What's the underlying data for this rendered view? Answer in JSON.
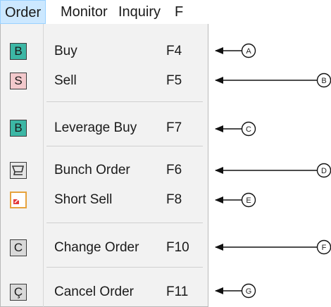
{
  "menubar": {
    "items": [
      "Order",
      "Monitor",
      "Inquiry",
      "F"
    ],
    "active": "Order"
  },
  "menu": {
    "items": [
      {
        "icon": "buy-icon",
        "icon_char": "B",
        "icon_bg": "#3cb7a5",
        "label": "Buy",
        "shortcut": "F4",
        "callout": "A"
      },
      {
        "icon": "sell-icon",
        "icon_char": "S",
        "icon_bg": "#f3c9cc",
        "label": "Sell",
        "shortcut": "F5",
        "callout": "B"
      },
      {
        "icon": "leverage-buy-icon",
        "icon_char": "B",
        "icon_bg": "#3cb7a5",
        "label": "Leverage Buy",
        "shortcut": "F7",
        "callout": "C"
      },
      {
        "icon": "bunch-order-icon",
        "icon_char": "",
        "icon_bg": "#e6e6e6",
        "label": "Bunch Order",
        "shortcut": "F6",
        "callout": "D"
      },
      {
        "icon": "short-sell-icon",
        "icon_char": "↗",
        "icon_bg": "#ffffff",
        "label": "Short Sell",
        "shortcut": "F8",
        "callout": "E"
      },
      {
        "icon": "change-order-icon",
        "icon_char": "C",
        "icon_bg": "#d9d9d9",
        "label": "Change Order",
        "shortcut": "F10",
        "callout": "F"
      },
      {
        "icon": "cancel-order-icon",
        "icon_char": "Ç",
        "icon_bg": "#d9d9d9",
        "label": "Cancel Order",
        "shortcut": "F11",
        "callout": "G"
      }
    ]
  },
  "colors": {
    "menu_bg": "#f2f2f2",
    "active_menu_bg": "#cce8ff",
    "active_menu_border": "#99d1ff"
  }
}
